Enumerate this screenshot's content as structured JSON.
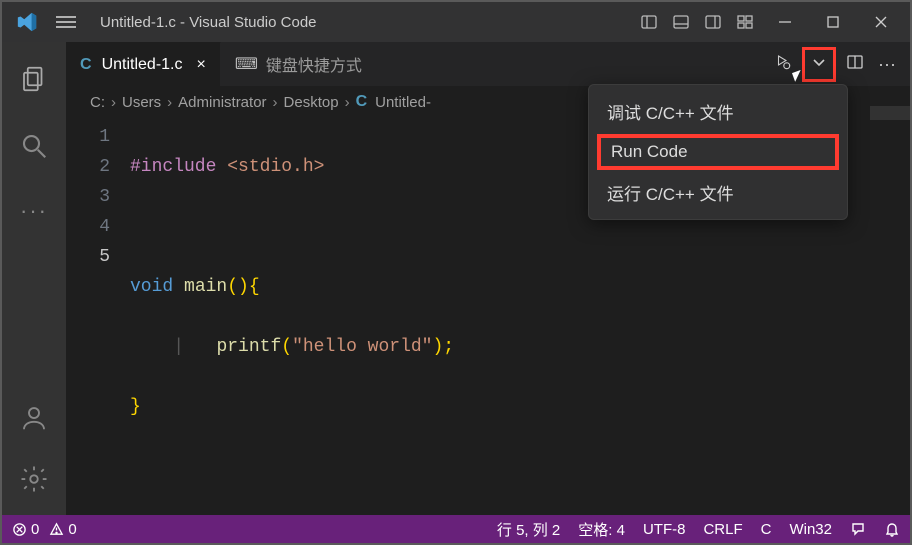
{
  "title": "Untitled-1.c - Visual Studio Code",
  "tabs": {
    "active": {
      "icon": "C",
      "label": "Untitled-1.c"
    },
    "other": {
      "label": "键盘快捷方式"
    }
  },
  "breadcrumbs": {
    "parts": [
      "C:",
      "Users",
      "Administrator",
      "Desktop"
    ],
    "file_icon": "C",
    "file": "Untitled-"
  },
  "code": {
    "line_numbers": [
      "1",
      "2",
      "3",
      "4",
      "5"
    ],
    "l1_macro": "#include",
    "l1_inc": "<stdio.h>",
    "l3_kw1": "void",
    "l3_fn": "main",
    "l3_paren": "()",
    "l3_brace": "{",
    "l4_fn": "printf",
    "l4_open": "(",
    "l4_str": "\"hello world\"",
    "l4_end": ");",
    "l5_brace": "}"
  },
  "dropdown": {
    "items": [
      "调试 C/C++ 文件",
      "Run Code",
      "运行 C/C++ 文件"
    ]
  },
  "status": {
    "errors_prefix": "0",
    "warnings_prefix": "0",
    "ln_col": "行 5, 列 2",
    "spaces": "空格: 4",
    "encoding": "UTF-8",
    "eol": "CRLF",
    "lang": "C",
    "target": "Win32"
  }
}
